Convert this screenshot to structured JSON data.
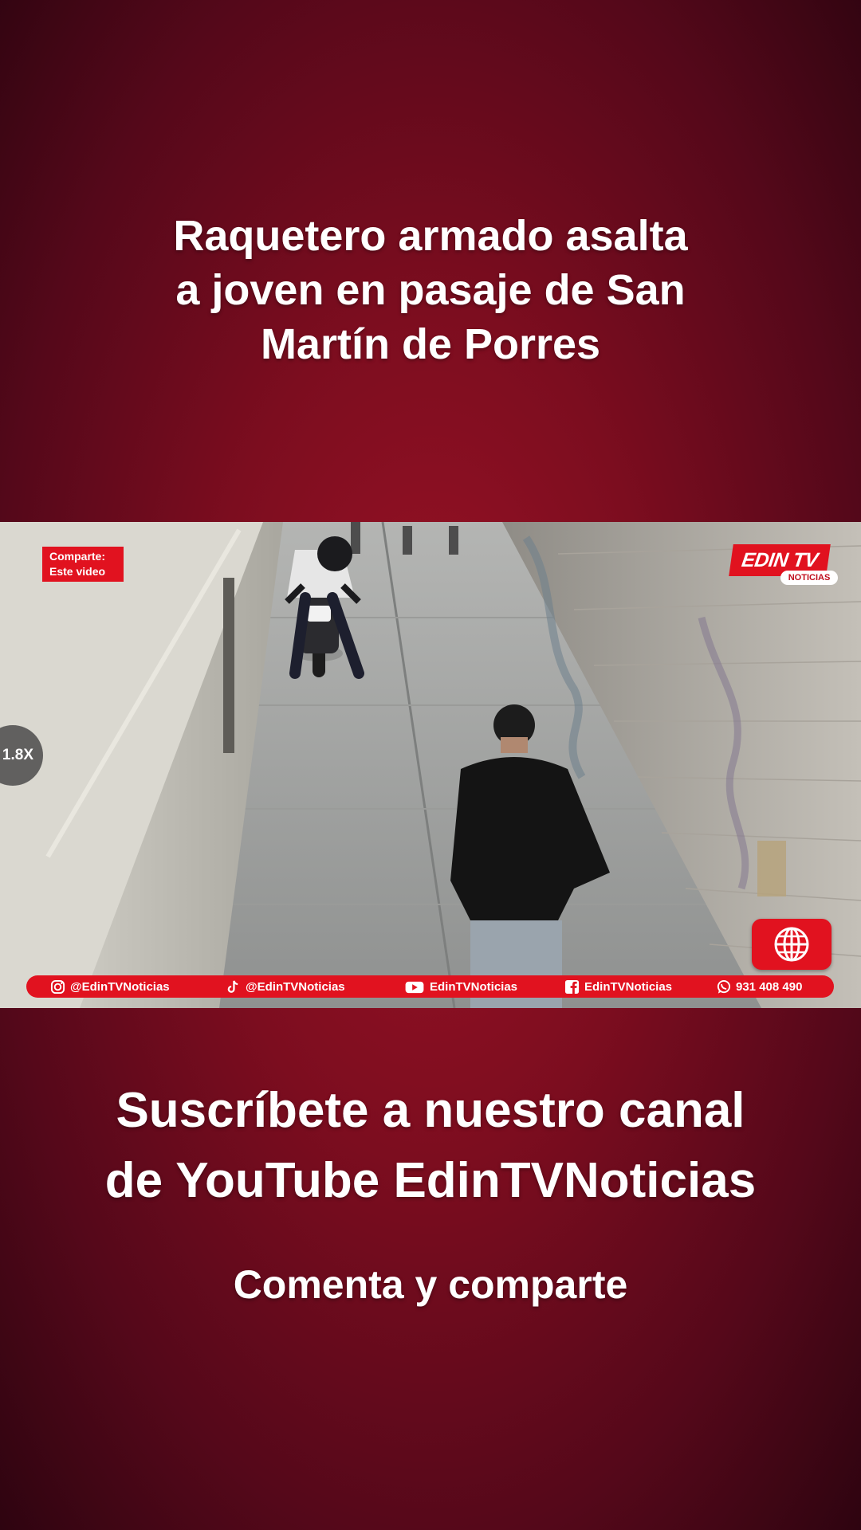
{
  "headline": {
    "line1": "Raquetero armado asalta",
    "line2": "a joven en pasaje de San",
    "line3": "Martín de Porres"
  },
  "video": {
    "share_line1": "Comparte:",
    "share_line2": "Este video",
    "speed": "1.8X",
    "logo_main": "EDIN TV",
    "logo_sub": "NOTICIAS"
  },
  "social": {
    "instagram": "@EdinTVNoticias",
    "tiktok": "@EdinTVNoticias",
    "youtube": "EdinTVNoticias",
    "facebook": "EdinTVNoticias",
    "whatsapp": "931 408 490"
  },
  "cta": {
    "line1": "Suscríbete a nuestro canal",
    "line2": "de YouTube EdinTVNoticias",
    "sub": "Comenta y comparte"
  },
  "colors": {
    "brand_red": "#e1121f",
    "background": "#7c0d1f"
  }
}
